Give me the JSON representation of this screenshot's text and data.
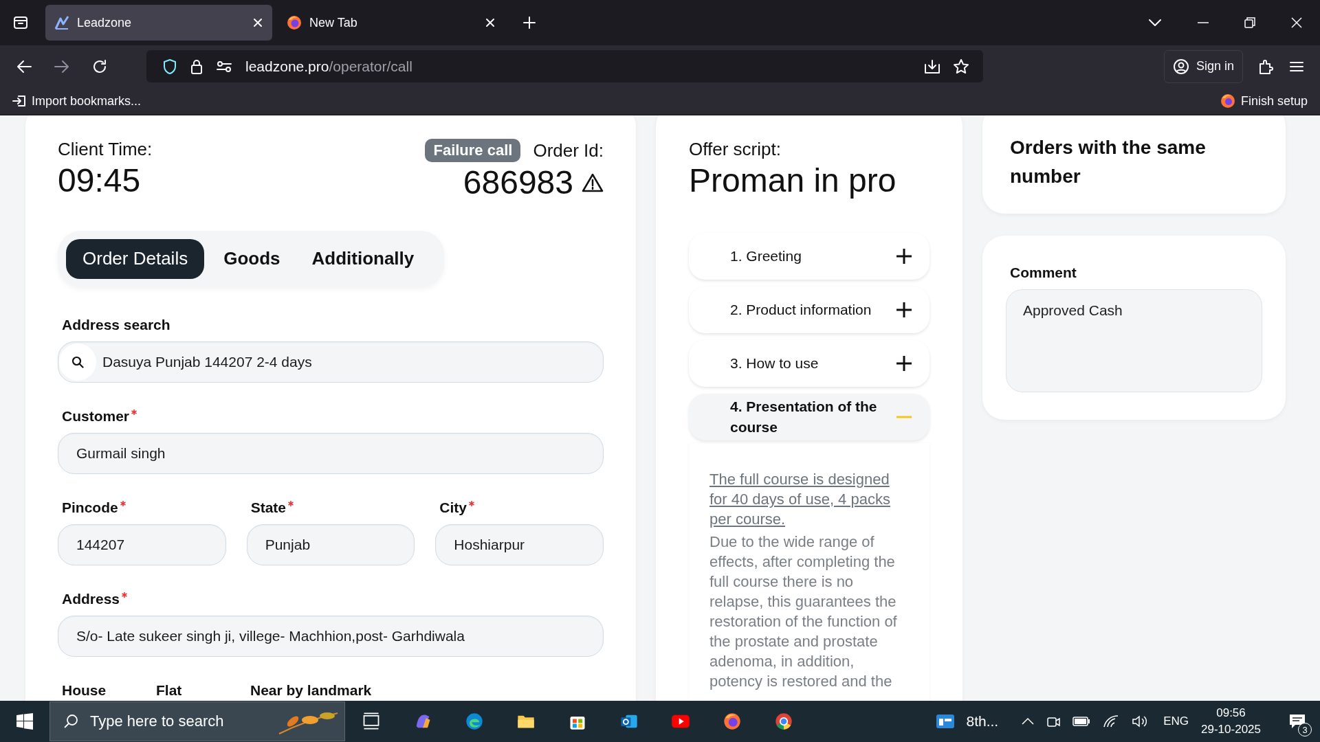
{
  "browser": {
    "tabs": [
      {
        "title": "Leadzone",
        "selected": true,
        "kind": "leadzone"
      },
      {
        "title": "New Tab",
        "selected": false,
        "kind": "firefox"
      }
    ],
    "url": {
      "host": "leadzone.pro",
      "path": "/operator/call"
    },
    "sign_in": "Sign in",
    "bookmarks": [
      "Import bookmarks..."
    ],
    "finish_setup": "Finish setup"
  },
  "order": {
    "client_time_label": "Client Time:",
    "client_time": "09:45",
    "status_badge": "Failure call",
    "order_id_label": "Order Id:",
    "order_id": "686983",
    "tabs": [
      {
        "label": "Order Details",
        "selected": true
      },
      {
        "label": "Goods",
        "selected": false
      },
      {
        "label": "Additionally",
        "selected": false
      }
    ],
    "address_search": {
      "label": "Address search",
      "value": "Dasuya Punjab 144207 2-4 days"
    },
    "rows": [
      [
        {
          "label": "Customer",
          "required": true,
          "value": "Gurmail singh"
        }
      ],
      [
        {
          "label": "Pincode",
          "required": true,
          "value": "144207"
        },
        {
          "label": "State",
          "required": true,
          "value": "Punjab"
        },
        {
          "label": "City",
          "required": true,
          "value": "Hoshiarpur"
        }
      ],
      [
        {
          "label": "Address",
          "required": true,
          "value": "S/o- Late sukeer singh ji, villege- Machhion,post- Garhdiwala"
        }
      ]
    ],
    "last_row_labels": [
      "House",
      "Flat",
      "Near by landmark"
    ]
  },
  "script": {
    "label": "Offer script:",
    "title": "Proman in pro",
    "steps": [
      {
        "label": "1. Greeting",
        "expanded": false
      },
      {
        "label": "2. Product information",
        "expanded": false
      },
      {
        "label": "3. How to use",
        "expanded": false
      },
      {
        "label": "4. Presentation of the course",
        "expanded": true
      }
    ],
    "body_link": "The full course is designed for 40 days of use, 4 packs per course.",
    "body_text": "Due to the wide range of effects, after completing the full course there is no relapse, this guarantees the restoration of the function of the prostate and prostate adenoma, in addition, potency is restored and the"
  },
  "same_number": {
    "title": "Orders with the same number"
  },
  "comment": {
    "label": "Comment",
    "value": "Approved Cash"
  },
  "taskbar": {
    "search_placeholder": "Type here to search",
    "widget": "8th...",
    "language": "ENG",
    "time": "09:56",
    "date": "29-10-2025",
    "notifications": "3"
  }
}
